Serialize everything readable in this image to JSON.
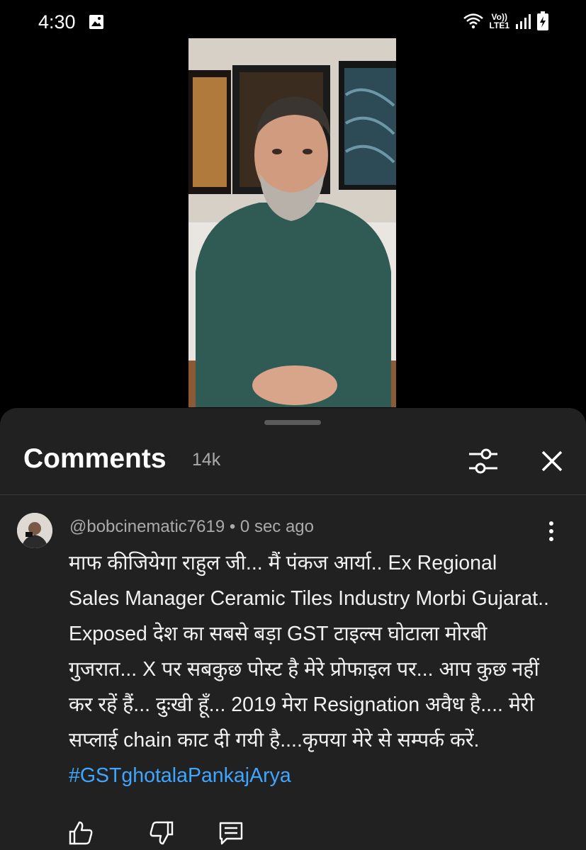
{
  "status_bar": {
    "time": "4:30",
    "network_top": "Vo))",
    "network_bottom": "LTE1",
    "icons": [
      "gallery-icon",
      "wifi-icon",
      "signal-icon",
      "battery-charging-icon"
    ]
  },
  "video": {
    "icon_names": [
      "person-video-thumbnail"
    ]
  },
  "comments": {
    "title": "Comments",
    "count": "14k",
    "icons": [
      "filter-icon",
      "close-icon"
    ]
  },
  "comment": {
    "author": "@bobcinematic7619",
    "separator": "•",
    "time": "0 sec ago",
    "text": "माफ कीजियेगा राहुल जी... मैं पंकज आर्या.. Ex Regional Sales Manager Ceramic Tiles Industry Morbi Gujarat.. Exposed देश का सबसे बड़ा GST  टाइल्स घोटाला मोरबी गुजरात... X पर सबकुछ पोस्ट है मेरे प्रोफाइल पर... आप कुछ नहीं कर रहें हैं... दुःखी हूँ... 2019  मेरा Resignation अवैध है....  मेरी सप्लाई chain काट दी गयी है....कृपया मेरे से सम्पर्क करें.",
    "hashtag": "#GSTghotalaPankajArya",
    "icons": [
      "more-vertical-icon",
      "thumbs-up-icon",
      "thumbs-down-icon",
      "reply-icon"
    ]
  },
  "colors": {
    "background": "#000000",
    "sheet": "#212121",
    "link": "#3ea6ff",
    "muted_text": "#aaaaaa"
  }
}
